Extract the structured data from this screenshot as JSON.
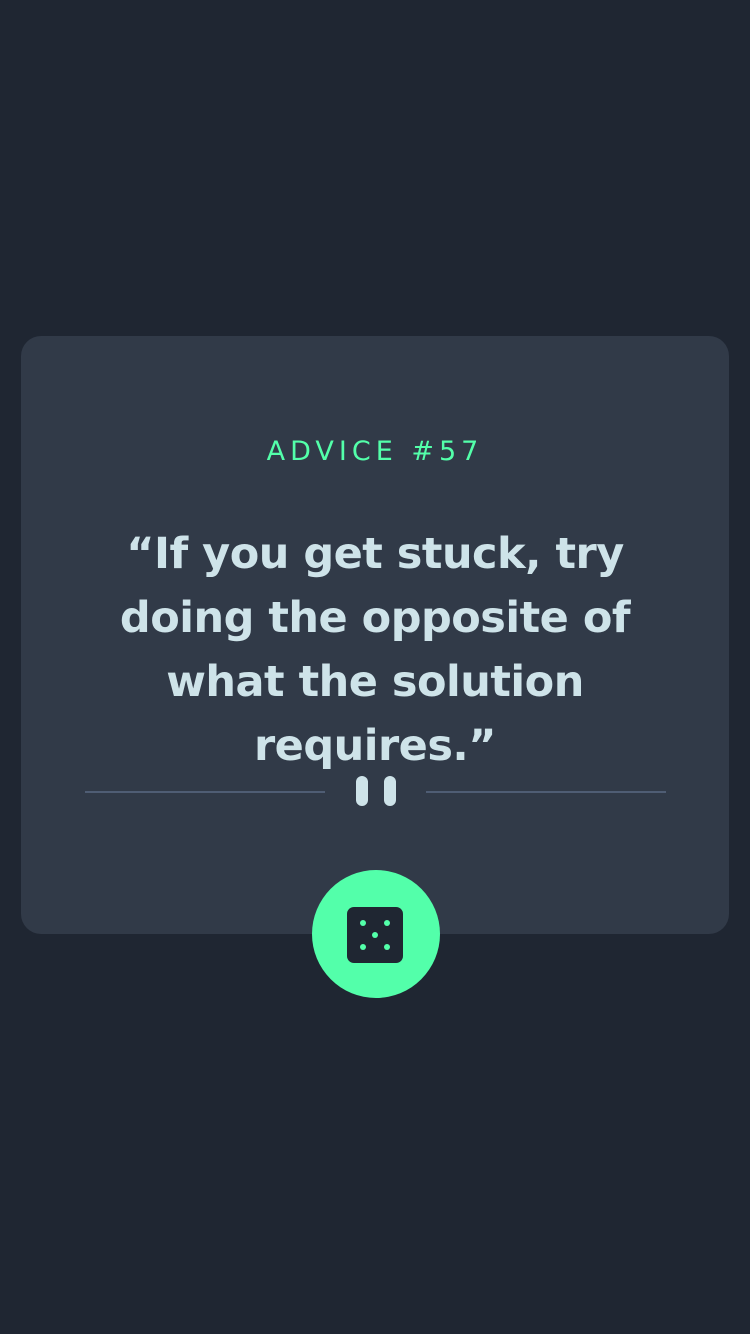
{
  "advice": {
    "id_label": "ADVICE #57",
    "quote": "“If you get stuck, try doing the opposite of what the solution requires.”"
  },
  "divider": {
    "icon": "pause-icon"
  },
  "generate_button": {
    "icon": "dice-icon"
  },
  "colors": {
    "background": "#1f2632",
    "card": "#313a48",
    "accent": "#53ffaa",
    "text": "#cee3e9",
    "divider_line": "#4f5d74"
  }
}
